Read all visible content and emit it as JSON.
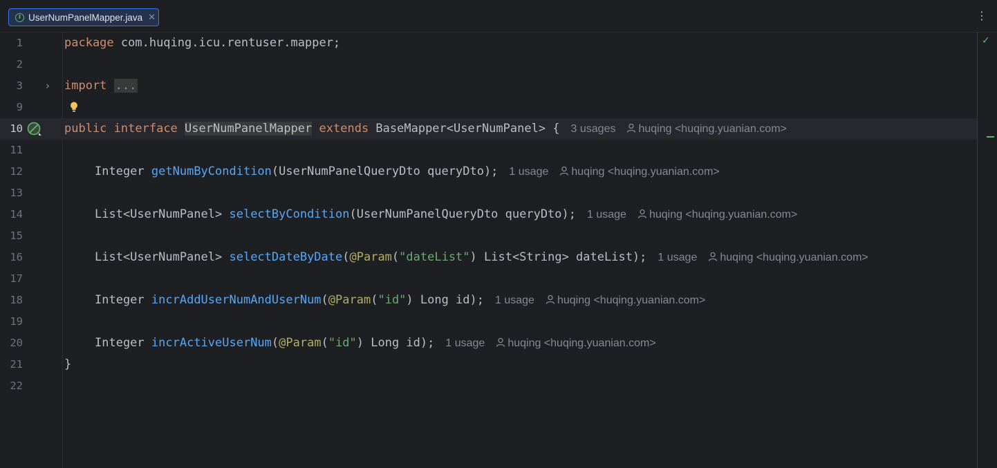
{
  "tab": {
    "label": "UserNumPanelMapper.java",
    "icon": "interface-icon"
  },
  "colors": {
    "background": "#1e1f22",
    "keyword": "#cf8e6d",
    "function": "#56a8f5",
    "annotation": "#b3ae60",
    "string": "#6aab73",
    "accent": "#3574f0",
    "ok": "#5fb865"
  },
  "author": "huqing <huqing.yuanian.com>",
  "lines": [
    {
      "num": "1"
    },
    {
      "num": "2"
    },
    {
      "num": "3"
    },
    {
      "num": "9"
    },
    {
      "num": "10"
    },
    {
      "num": "11"
    },
    {
      "num": "12"
    },
    {
      "num": "13"
    },
    {
      "num": "14"
    },
    {
      "num": "15"
    },
    {
      "num": "16"
    },
    {
      "num": "17"
    },
    {
      "num": "18"
    },
    {
      "num": "19"
    },
    {
      "num": "20"
    },
    {
      "num": "21"
    },
    {
      "num": "22"
    }
  ],
  "code": {
    "l1_kw": "package",
    "l1_rest": " com.huqing.icu.rentuser.mapper;",
    "l3_kw": "import",
    "l3_fold": "...",
    "l10_kw1": "public",
    "l10_kw2": "interface",
    "l10_name": "UserNumPanelMapper",
    "l10_kw3": "extends",
    "l10_rest": " BaseMapper<UserNumPanel> {",
    "l10_usages": "3 usages",
    "l12_type": "Integer",
    "l12_fn": "getNumByCondition",
    "l12_rest": "(UserNumPanelQueryDto queryDto);",
    "l12_usages": "1 usage",
    "l14_type": "List<UserNumPanel>",
    "l14_fn": "selectByCondition",
    "l14_rest": "(UserNumPanelQueryDto queryDto);",
    "l14_usages": "1 usage",
    "l16_type": "List<UserNumPanel>",
    "l16_fn": "selectDateByDate",
    "l16_ann": "@Param",
    "l16_str": "\"dateList\"",
    "l16_rest": ") List<String> dateList);",
    "l16_usages": "1 usage",
    "l18_type": "Integer",
    "l18_fn": "incrAddUserNumAndUserNum",
    "l18_ann": "@Param",
    "l18_str": "\"id\"",
    "l18_rest": ") Long id);",
    "l18_usages": "1 usage",
    "l20_type": "Integer",
    "l20_fn": "incrActiveUserNum",
    "l20_ann": "@Param",
    "l20_str": "\"id\"",
    "l20_rest": ") Long id);",
    "l20_usages": "1 usage",
    "l21": "}"
  }
}
